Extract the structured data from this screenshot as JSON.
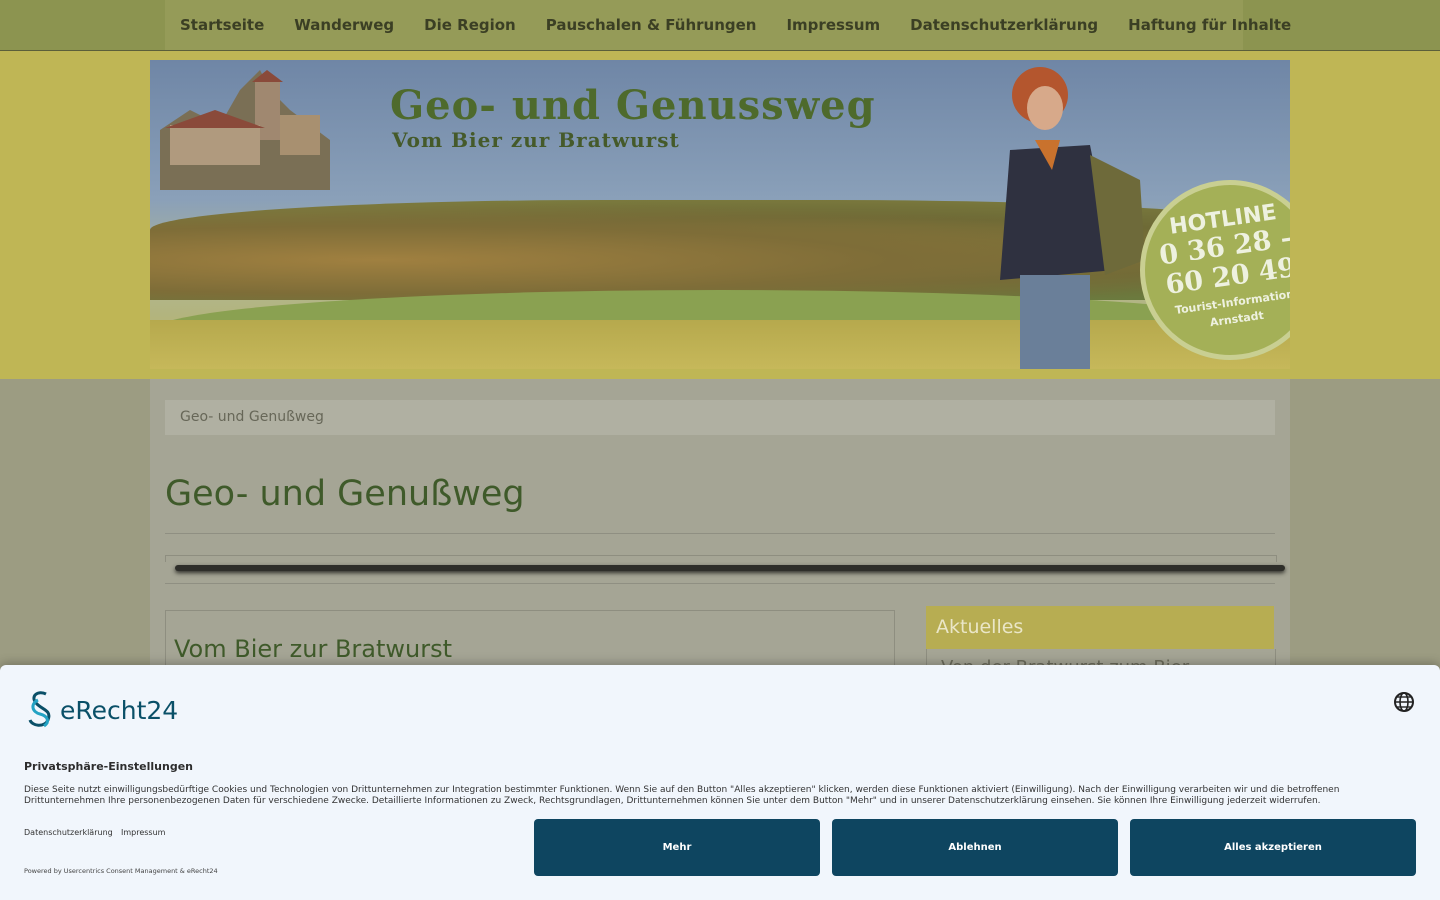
{
  "nav": {
    "items": [
      "Startseite",
      "Wanderweg",
      "Die Region",
      "Pauschalen & Führungen",
      "Impressum",
      "Datenschutzerklärung",
      "Haftung für Inhalte"
    ]
  },
  "banner": {
    "title": "Geo- und Genussweg",
    "subtitle": "Vom Bier zur Bratwurst",
    "hotline_label": "HOTLINE",
    "hotline_number_1": "0 36 28 –",
    "hotline_number_2": "60 20 49",
    "hotline_org_1": "Tourist-Information",
    "hotline_org_2": "Arnstadt"
  },
  "breadcrumb": "Geo- und Genußweg",
  "page_title": "Geo- und Genußweg",
  "article": {
    "heading": "Vom Bier zur Bratwurst"
  },
  "sidebar": {
    "heading": "Aktuelles",
    "first_item": "Von der Bratwurst zum Bier"
  },
  "consent": {
    "brand": "eRecht24",
    "title": "Privatsphäre-Einstellungen",
    "text": "Diese Seite nutzt einwilligungsbedürftige Cookies und Technologien von Drittunternehmen zur Integration bestimmter Funktionen. Wenn Sie auf den Button \"Alles akzeptieren\" klicken, werden diese Funktionen aktiviert (Einwilligung). Nach der Einwilligung verarbeiten wir und die betroffenen Drittunternehmen Ihre personenbezogenen Daten für verschiedene Zwecke. Detaillierte Informationen zu Zweck, Rechtsgrundlagen, Drittunternehmen können Sie unter dem Button \"Mehr\" und in unserer Datenschutzerklärung einsehen. Sie können Ihre Einwilligung jederzeit widerrufen.",
    "link_privacy": "Datenschutzerklärung",
    "link_imprint": "Impressum",
    "powered": "Powered by Usercentrics Consent Management & eRecht24",
    "btn_more": "Mehr",
    "btn_decline": "Ablehnen",
    "btn_accept": "Alles akzeptieren"
  },
  "colors": {
    "button": "#0e4560",
    "brand": "#0a5068",
    "sidebar_header": "#b7ad52"
  }
}
